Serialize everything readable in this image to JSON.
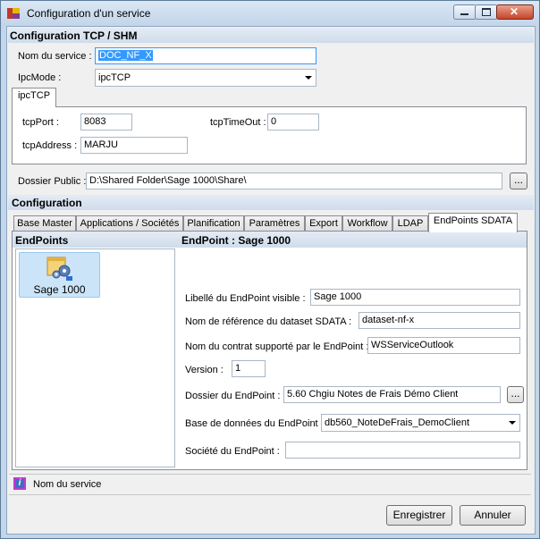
{
  "window": {
    "title": "Configuration d'un service"
  },
  "tcp_section": {
    "header": "Configuration TCP / SHM",
    "service_name_label": "Nom du service :",
    "service_name_value": "DOC_NF_X",
    "ipcmode_label": "IpcMode :",
    "ipcmode_value": "ipcTCP",
    "ipc_tab_label": "ipcTCP",
    "tcpport_label": "tcpPort :",
    "tcpport_value": "8083",
    "tcptimeout_label": "tcpTimeOut :",
    "tcptimeout_value": "0",
    "tcpaddress_label": "tcpAddress :",
    "tcpaddress_value": "MARJU",
    "public_folder_label": "Dossier Public :",
    "public_folder_value": "D:\\Shared Folder\\Sage 1000\\Share\\",
    "browse_label": "..."
  },
  "config_section": {
    "header": "Configuration",
    "tabs": [
      "Base Master",
      "Applications / Sociétés",
      "Planification",
      "Paramètres",
      "Export",
      "Workflow",
      "LDAP",
      "EndPoints SDATA"
    ]
  },
  "endpoints": {
    "list_header": "EndPoints",
    "items": [
      {
        "label": "Sage 1000"
      }
    ],
    "detail_header": "EndPoint : Sage 1000",
    "visible_label_label": "Libellé du EndPoint visible  :",
    "visible_label_value": "Sage 1000",
    "dataset_ref_label": "Nom de référence du dataset SDATA :",
    "dataset_ref_value": "dataset-nf-x",
    "contract_label": "Nom du contrat supporté par le EndPoint :",
    "contract_value": "WSServiceOutlook",
    "version_label": "Version :",
    "version_value": "1",
    "folder_label": "Dossier du EndPoint :",
    "folder_value": "5.60 Chgiu Notes de Frais Démo Client",
    "browse_label": "...",
    "database_label": "Base de données du EndPoint :",
    "database_value": "db560_NoteDeFrais_DemoClient",
    "company_label": "Société du EndPoint :",
    "company_value": ""
  },
  "status": {
    "text": "Nom du service"
  },
  "footer": {
    "save_label": "Enregistrer",
    "cancel_label": "Annuler"
  },
  "colors": {
    "accent": "#3399ff",
    "title_bar": "#c4d6ea",
    "panel": "#f0f0f0"
  }
}
